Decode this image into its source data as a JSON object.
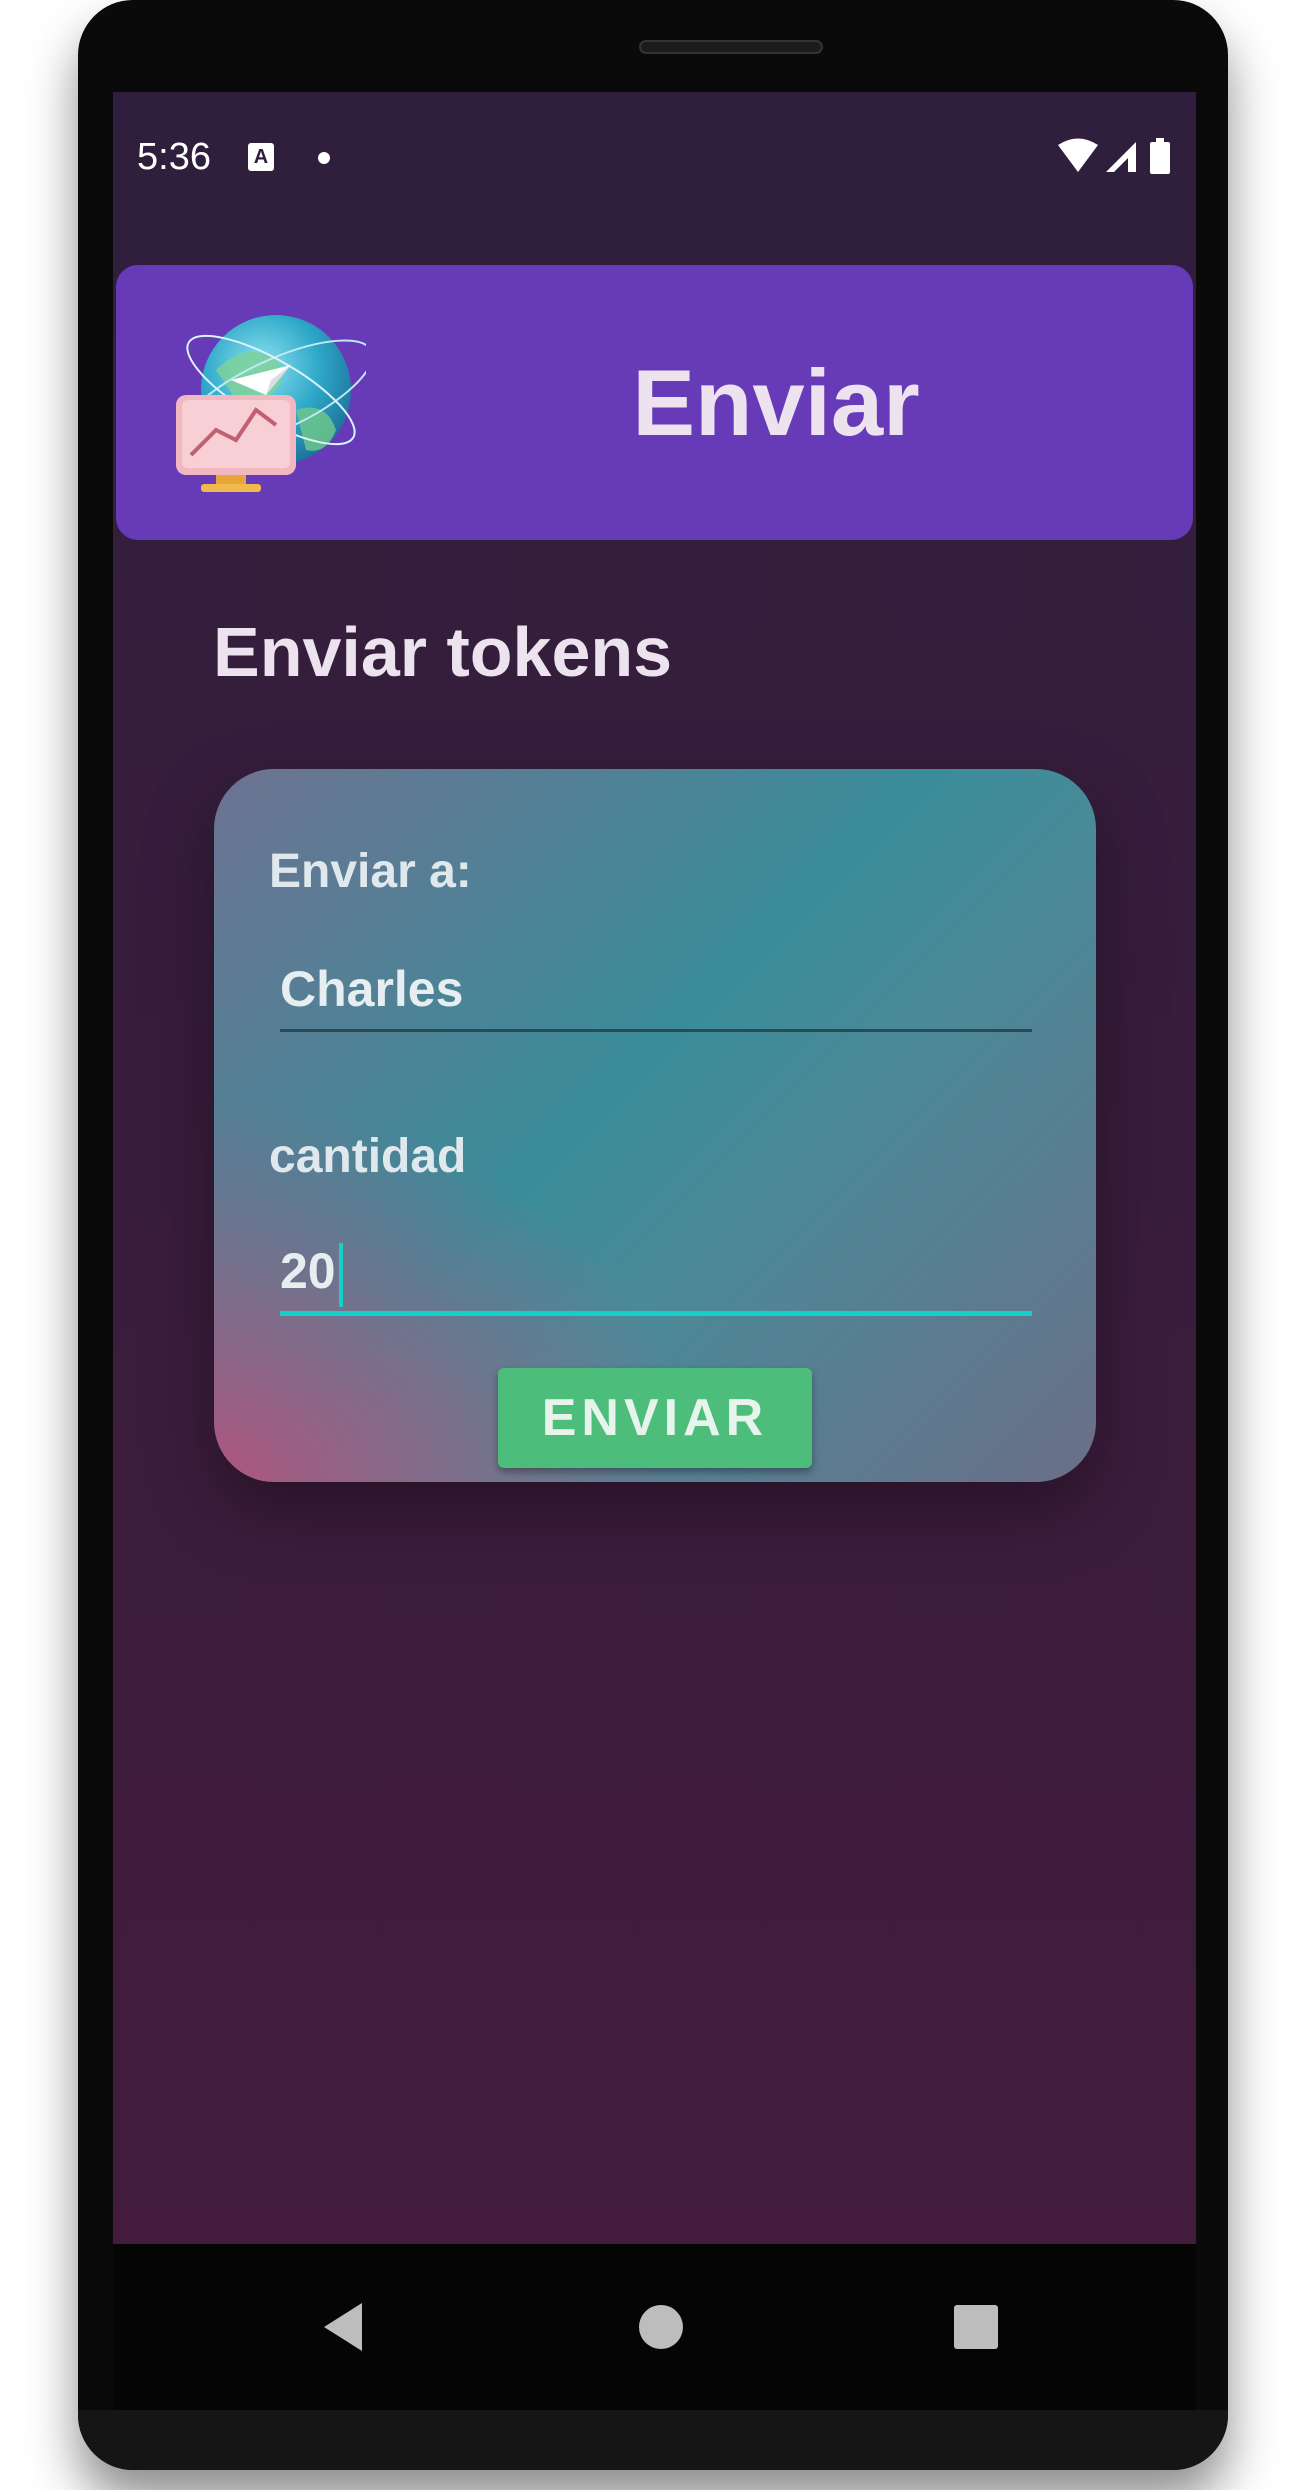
{
  "status_bar": {
    "time": "5:36",
    "icons": [
      "keyboard-a-icon",
      "notification-dot-icon",
      "wifi-icon",
      "signal-icon",
      "battery-icon"
    ]
  },
  "app_bar": {
    "title": "Enviar",
    "logo": "globe-send-illustration",
    "color": "#673ab7"
  },
  "page": {
    "section_title": "Enviar tokens"
  },
  "form": {
    "recipient_label": "Enviar a:",
    "recipient_value": "Charles",
    "amount_label": "cantidad",
    "amount_value": "20",
    "submit_label": "ENVIAR"
  },
  "nav_bar": {
    "buttons": [
      "back-icon",
      "home-icon",
      "recents-icon"
    ]
  },
  "colors": {
    "accent": "#14d0c8",
    "button": "#4dbd7c",
    "background": "#2f1e3d"
  }
}
